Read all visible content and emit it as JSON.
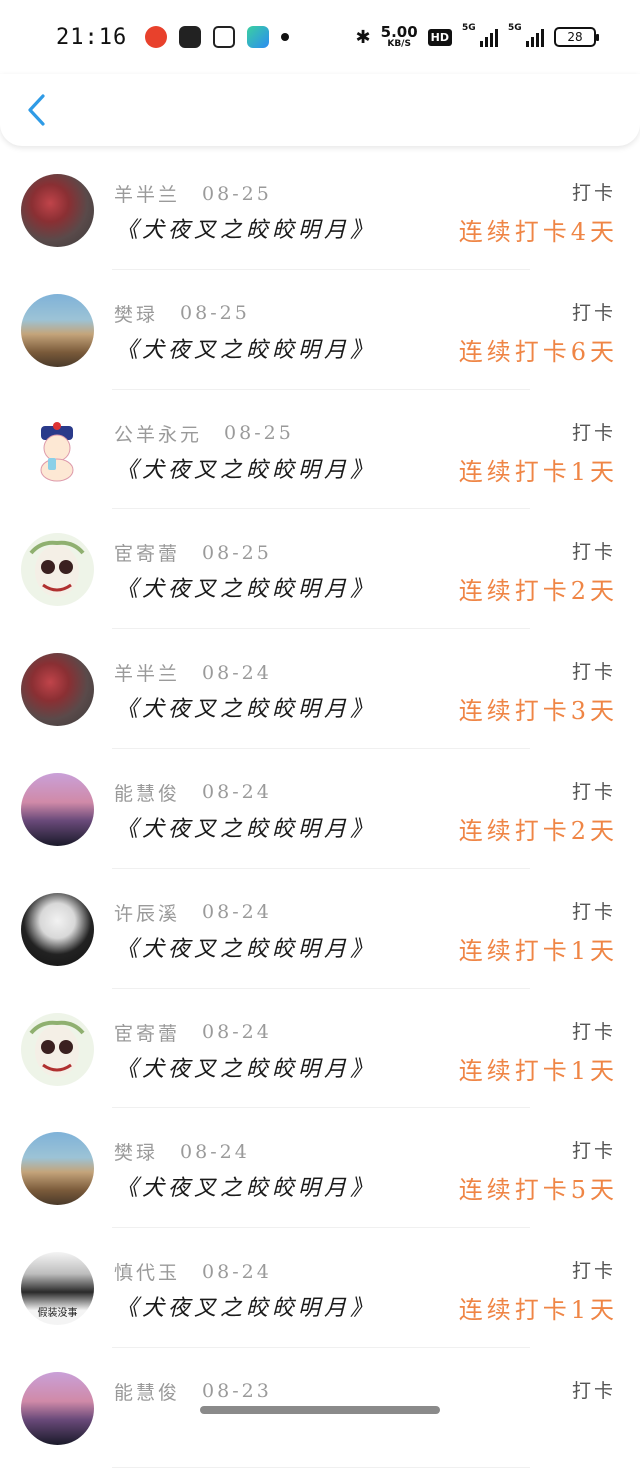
{
  "status_bar": {
    "time": "21:16",
    "speed_value": "5.00",
    "speed_unit": "KB/S",
    "hd_badge": "HD",
    "network_1": "5G",
    "network_2": "5G",
    "battery": "28"
  },
  "colors": {
    "accent_orange": "#ef8545",
    "back_blue": "#2f9be6"
  },
  "entries": [
    {
      "name": "羊半兰",
      "date": "08-25",
      "book": "《犬夜叉之皎皎明月》",
      "type": "打卡",
      "streak": "连续打卡4天"
    },
    {
      "name": "樊琭",
      "date": "08-25",
      "book": "《犬夜叉之皎皎明月》",
      "type": "打卡",
      "streak": "连续打卡6天"
    },
    {
      "name": "公羊永元",
      "date": "08-25",
      "book": "《犬夜叉之皎皎明月》",
      "type": "打卡",
      "streak": "连续打卡1天"
    },
    {
      "name": "宦寄蕾",
      "date": "08-25",
      "book": "《犬夜叉之皎皎明月》",
      "type": "打卡",
      "streak": "连续打卡2天"
    },
    {
      "name": "羊半兰",
      "date": "08-24",
      "book": "《犬夜叉之皎皎明月》",
      "type": "打卡",
      "streak": "连续打卡3天"
    },
    {
      "name": "能慧俊",
      "date": "08-24",
      "book": "《犬夜叉之皎皎明月》",
      "type": "打卡",
      "streak": "连续打卡2天"
    },
    {
      "name": "许辰溪",
      "date": "08-24",
      "book": "《犬夜叉之皎皎明月》",
      "type": "打卡",
      "streak": "连续打卡1天"
    },
    {
      "name": "宦寄蕾",
      "date": "08-24",
      "book": "《犬夜叉之皎皎明月》",
      "type": "打卡",
      "streak": "连续打卡1天"
    },
    {
      "name": "樊琭",
      "date": "08-24",
      "book": "《犬夜叉之皎皎明月》",
      "type": "打卡",
      "streak": "连续打卡5天"
    },
    {
      "name": "慎代玉",
      "date": "08-24",
      "book": "《犬夜叉之皎皎明月》",
      "type": "打卡",
      "streak": "连续打卡1天",
      "avatar_text": "假装没事"
    },
    {
      "name": "能慧俊",
      "date": "08-23",
      "book": "",
      "type": "打卡",
      "streak": ""
    }
  ]
}
